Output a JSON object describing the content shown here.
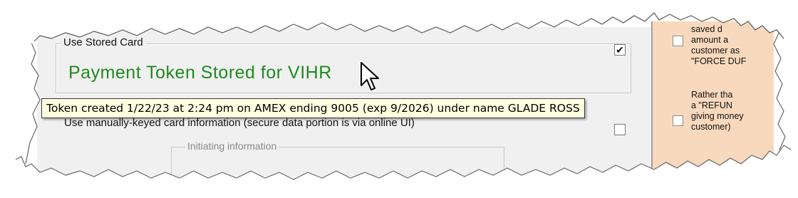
{
  "stored_card": {
    "legend": "Use Stored Card",
    "checked_mark": "✔",
    "token_title": "Payment Token Stored for VIHR"
  },
  "tooltip": {
    "text": "Token created 1/22/23 at 2:24 pm on AMEX ending 9005 (exp 9/2026) under name GLADE ROSS"
  },
  "manual_card": {
    "label": "Use manually-keyed card information (secure data portion is via online UI)"
  },
  "initiating": {
    "legend": "Initiating information"
  },
  "right_pane": {
    "lines_block1": [
      "saved d",
      "amount a",
      "customer as",
      "\"FORCE DUF"
    ],
    "lines_block2": [
      "Rather tha",
      "a \"REFUN",
      "giving money",
      "customer)"
    ]
  },
  "colors": {
    "token_title": "#1f8a1f",
    "tooltip_bg": "#ffffe1",
    "right_pane_bg": "#f9d9bd",
    "dialog_bg": "#f0f0f0"
  }
}
